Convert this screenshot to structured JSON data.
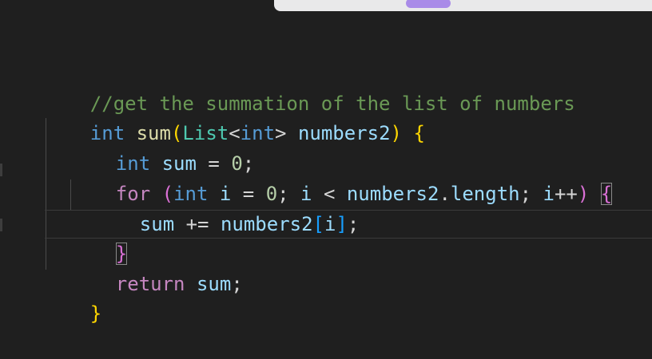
{
  "editor": {
    "lines": [
      {
        "tokens": [
          "//get the summation of the list of numbers"
        ]
      },
      {
        "tokens": [
          "int",
          " ",
          "sum",
          "(",
          "List",
          "<",
          "int",
          ">",
          " ",
          "numbers2",
          ")",
          " ",
          "{"
        ]
      },
      {
        "tokens": [
          "int",
          " ",
          "sum",
          " = ",
          "0",
          ";"
        ]
      },
      {
        "tokens": [
          "for",
          " ",
          "(",
          "int",
          " ",
          "i",
          " = ",
          "0",
          "; ",
          "i",
          " < ",
          "numbers2",
          ".",
          "length",
          "; ",
          "i",
          "++",
          ")",
          " ",
          "{"
        ]
      },
      {
        "tokens": [
          "sum",
          " += ",
          "numbers2",
          "[",
          "i",
          "]",
          ";"
        ]
      },
      {
        "tokens": [
          "}"
        ]
      },
      {
        "tokens": [
          "return",
          " ",
          "sum",
          ";"
        ]
      },
      {
        "tokens": [
          "}"
        ]
      }
    ]
  },
  "colors": {
    "background": "#1f1f1f",
    "comment": "#6a9955",
    "keyword": "#569cd6",
    "control": "#c586c0",
    "function": "#dcdcaa",
    "type": "#4ec9b0",
    "variable": "#9cdcfe",
    "number": "#b5cea8",
    "bracket_level1": "#ffd700",
    "bracket_level2": "#da70d6",
    "bracket_level3": "#179fff"
  }
}
